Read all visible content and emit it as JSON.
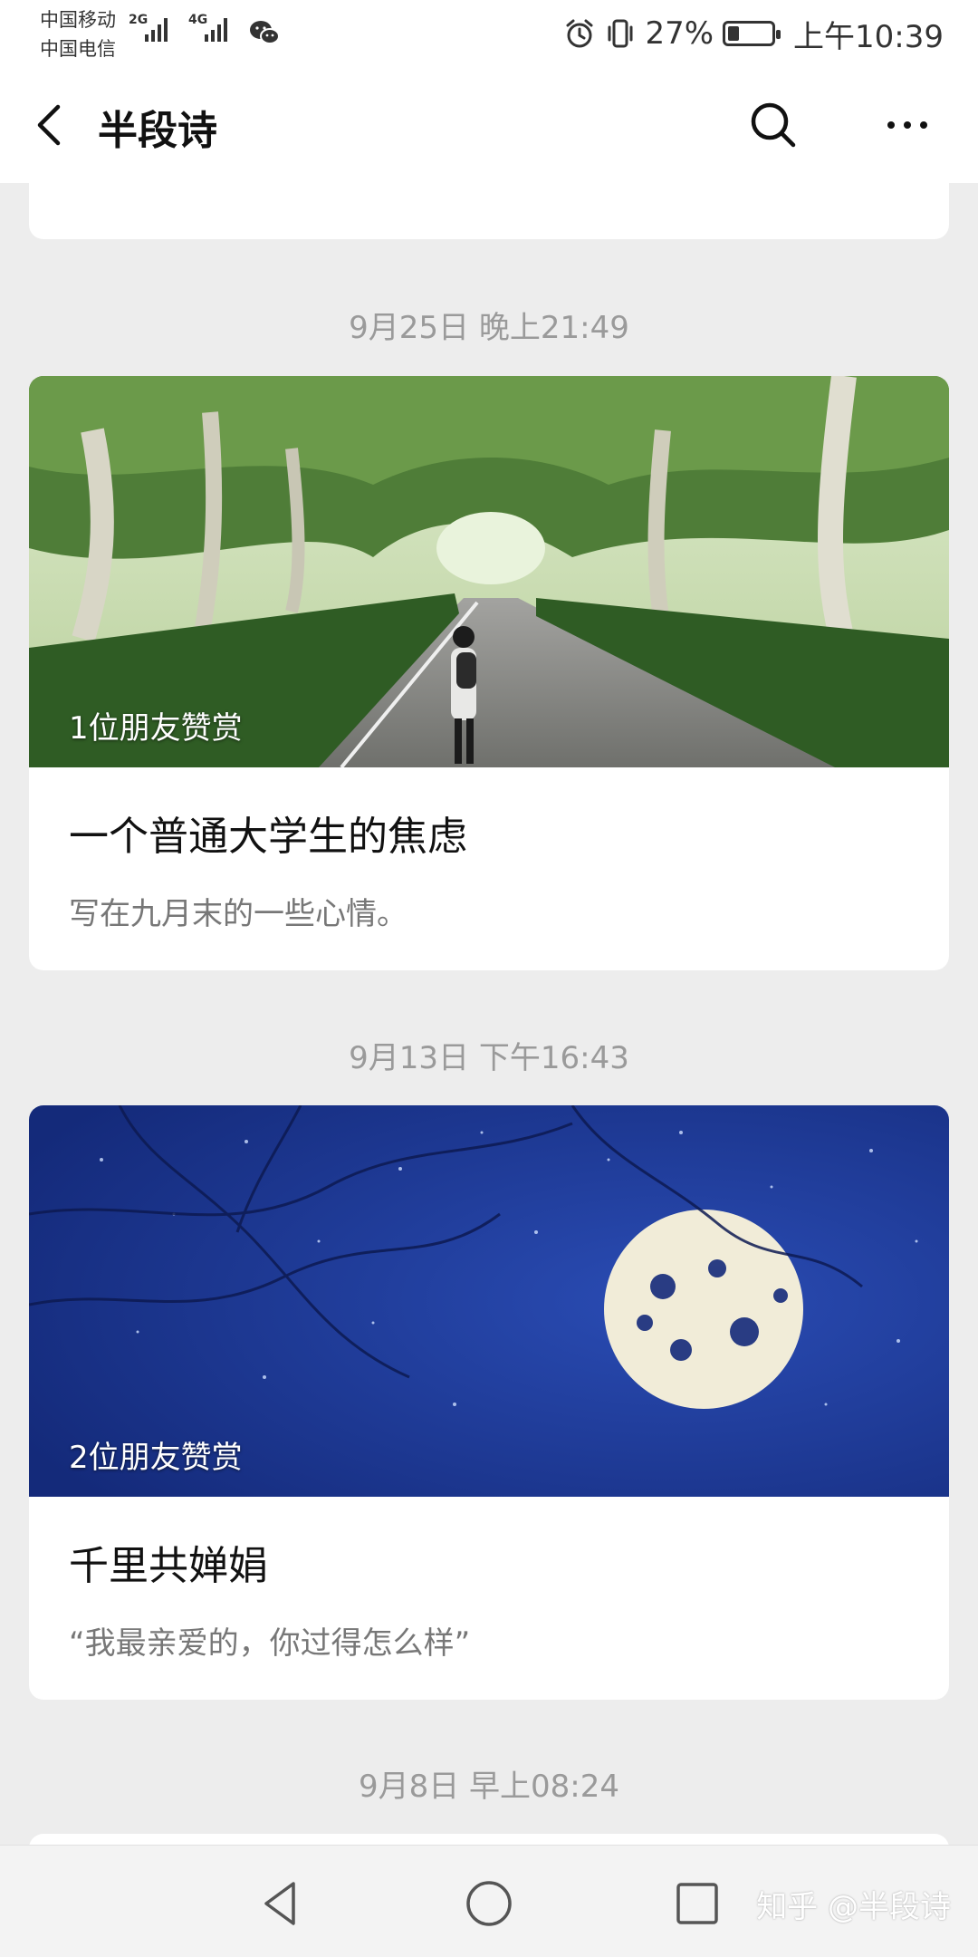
{
  "status_bar": {
    "carrier_1": "中国移动",
    "carrier_2": "中国电信",
    "signal_1_tag": "2G",
    "signal_2_tag": "4G",
    "battery_percent": "27%",
    "battery_level": 0.27,
    "time": "上午10:39"
  },
  "header": {
    "title": "半段诗"
  },
  "feed": [
    {
      "date": "9月25日 晚上21:49",
      "appreciation": "1位朋友赞赏",
      "title": "一个普通大学生的焦虑",
      "desc": "写在九月末的一些心情。"
    },
    {
      "date": "9月13日 下午16:43",
      "appreciation": "2位朋友赞赏",
      "title": "千里共婵娟",
      "desc": "“我最亲爱的，你过得怎么样”"
    },
    {
      "date": "9月8日 早上08:24"
    }
  ],
  "watermark": "知乎 @半段诗",
  "colors": {
    "background": "#ededed",
    "card": "#ffffff",
    "night_blue": "#1e3a9a"
  },
  "icons": [
    "back-icon",
    "search-icon",
    "more-icon",
    "alarm-icon",
    "vibrate-icon",
    "battery-icon",
    "wechat-icon",
    "nav-back-icon",
    "nav-home-icon",
    "nav-recents-icon"
  ]
}
